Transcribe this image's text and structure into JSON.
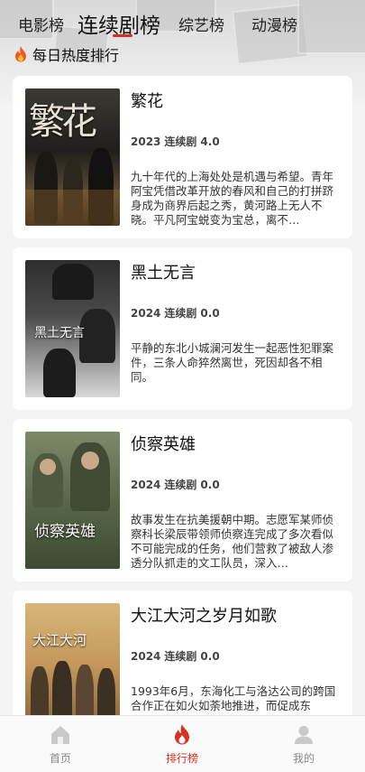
{
  "tabs": [
    {
      "label": "电影榜"
    },
    {
      "label": "连续剧榜"
    },
    {
      "label": "综艺榜"
    },
    {
      "label": "动漫榜"
    }
  ],
  "subtitle": "每日热度排行",
  "items": [
    {
      "title": "繁花",
      "year": "2023",
      "type": "连续剧",
      "score": "4.0",
      "desc": "九十年代的上海处处是机遇与希望。青年阿宝凭借改革开放的春风和自己的打拼跻身成为商界后起之秀，黄河路上无人不晓。平凡阿宝蜕变为宝总，离不…",
      "poster_text": "繁花"
    },
    {
      "title": "黑土无言",
      "year": "2024",
      "type": "连续剧",
      "score": "0.0",
      "desc": "平静的东北小城澜河发生一起恶性犯罪案件，三条人命猝然离世，死因却各不相同。",
      "poster_text": "黑土无言"
    },
    {
      "title": "侦察英雄",
      "year": "2024",
      "type": "连续剧",
      "score": "0.0",
      "desc": "故事发生在抗美援朝中期。志愿军某师侦察科长梁辰带领师侦察连完成了多次看似不可能完成的任务，他们营救了被敌人渗透分队抓走的文工队员，深入…",
      "poster_text": "侦察英雄"
    },
    {
      "title": "大江大河之岁月如歌",
      "year": "2024",
      "type": "连续剧",
      "score": "0.0",
      "desc": "1993年6月，东海化工与洛达公司的跨国合作正在如火如荼地推进，而促成东",
      "poster_text": "大江大河"
    }
  ],
  "nav": [
    {
      "label": "首页",
      "icon": "home-icon"
    },
    {
      "label": "排行榜",
      "icon": "flame-icon"
    },
    {
      "label": "我的",
      "icon": "user-icon"
    }
  ],
  "colors": {
    "accent": "#d6331e",
    "background": "#f4f4f4",
    "card": "#ffffff"
  }
}
